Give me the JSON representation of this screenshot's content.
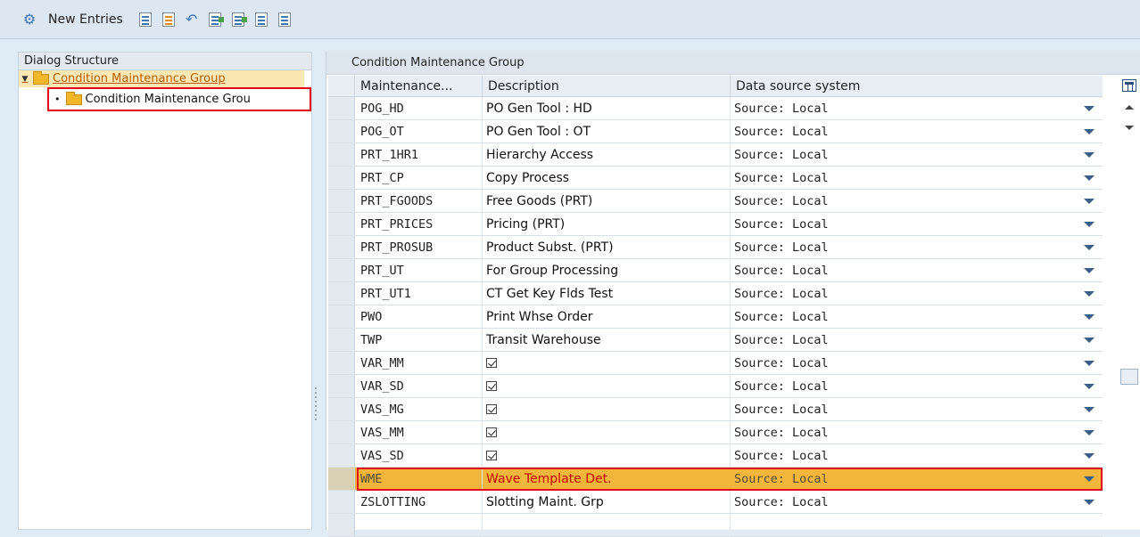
{
  "toolbar": {
    "new_entries_label": "New Entries"
  },
  "dialog_structure": {
    "title": "Dialog Structure",
    "root_label": "Condition Maintenance Group",
    "child_label": "Condition Maintenance Grou"
  },
  "table": {
    "title": "Condition Maintenance Group",
    "columns": [
      "Maintenance...",
      "Description",
      "Data source system"
    ],
    "rows": [
      {
        "code": "POG_HD",
        "desc": "PO Gen Tool : HD",
        "source": "Source: Local"
      },
      {
        "code": "POG_OT",
        "desc": "PO Gen Tool : OT",
        "source": "Source: Local"
      },
      {
        "code": "PRT_1HR1",
        "desc": "Hierarchy Access",
        "source": "Source: Local"
      },
      {
        "code": "PRT_CP",
        "desc": "Copy Process",
        "source": "Source: Local"
      },
      {
        "code": "PRT_FGOODS",
        "desc": "Free Goods (PRT)",
        "source": "Source: Local"
      },
      {
        "code": "PRT_PRICES",
        "desc": "Pricing (PRT)",
        "source": "Source: Local"
      },
      {
        "code": "PRT_PROSUB",
        "desc": "Product Subst. (PRT)",
        "source": "Source: Local"
      },
      {
        "code": "PRT_UT",
        "desc": "For Group Processing",
        "source": "Source: Local"
      },
      {
        "code": "PRT_UT1",
        "desc": "CT Get Key Flds Test",
        "source": "Source: Local"
      },
      {
        "code": "PWO",
        "desc": "Print Whse Order",
        "source": "Source: Local"
      },
      {
        "code": "TWP",
        "desc": "Transit Warehouse",
        "source": "Source: Local"
      },
      {
        "code": "VAR_MM",
        "desc": "",
        "source": "Source: Local"
      },
      {
        "code": "VAR_SD",
        "desc": "",
        "source": "Source: Local"
      },
      {
        "code": "VAS_MG",
        "desc": "",
        "source": "Source: Local"
      },
      {
        "code": "VAS_MM",
        "desc": "",
        "source": "Source: Local"
      },
      {
        "code": "VAS_SD",
        "desc": "",
        "source": "Source: Local"
      },
      {
        "code": "WME",
        "desc": "Wave Template Det.",
        "source": "Source: Local"
      },
      {
        "code": "ZSLOTTING",
        "desc": "Slotting Maint. Grp",
        "source": "Source: Local"
      }
    ]
  },
  "colors": {
    "highlight_row": "#f3b63c",
    "red_border": "#e3001b"
  }
}
